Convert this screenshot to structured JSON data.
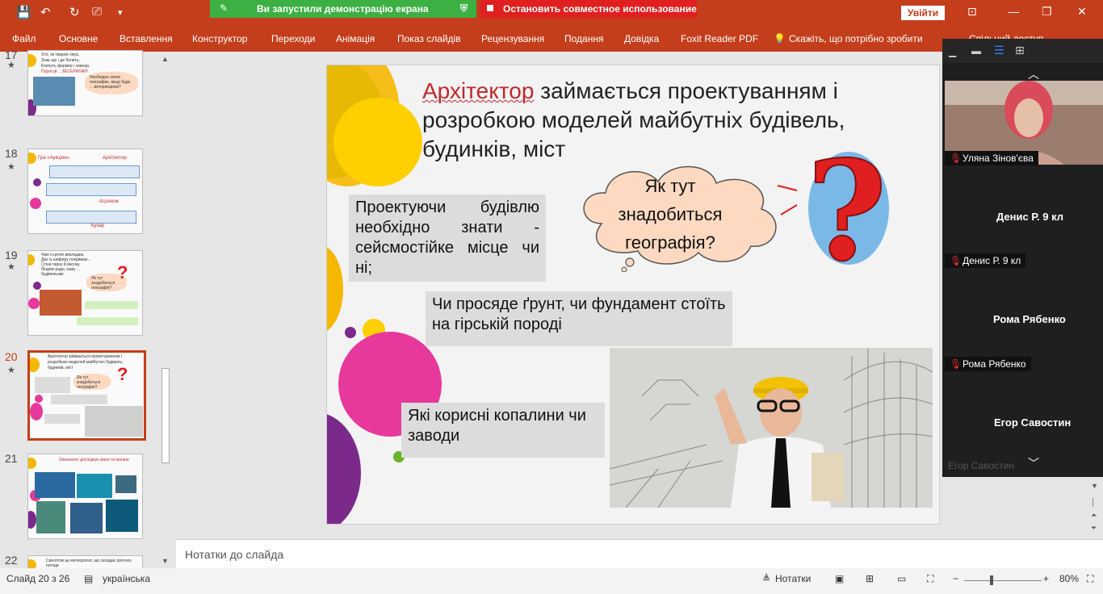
{
  "titlebar": {
    "save_icon": "save-icon",
    "share_banner": "Ви запустили демонстрацію екрана",
    "stop_banner": "Остановить совместное использование",
    "signin": "Увійти"
  },
  "ribbon": {
    "tabs": [
      "Файл",
      "Основне",
      "Вставлення",
      "Конструктор",
      "Переходи",
      "Анімація",
      "Показ слайдів",
      "Рецензування",
      "Подання",
      "Довідка",
      "Foxit Reader PDF",
      "Скажіть, що потрібно зробити",
      "Спільний доступ"
    ]
  },
  "thumbnails": [
    {
      "num": "17",
      "lines": [
        "Хто, як тварин лікує,",
        "Знає що і де болить,",
        "Кличуть фермер і свинар,",
        "Порятуй ... ВЕТЕРИНАР!"
      ],
      "bubble": "Необхідно знати географію, якщо буде ... ветеринаром?"
    },
    {
      "num": "18",
      "heading": "Гра «Аукціон»",
      "lines": [
        "Архітектор",
        "Агроном",
        "Кухар"
      ]
    },
    {
      "num": "19",
      "lines": [
        "Чим я цегли викладаю,",
        "Дах із шиферу покриваю...",
        "Стіни гарну й високу",
        "Людям радо, кажу ... будівельник"
      ],
      "bubble": "Як тут знадобиться географія?"
    },
    {
      "num": "20",
      "lines": [
        "Архітектор займається проектуванням і розробкою моделей майбутніх будівель, будинків, міст"
      ],
      "bubble": "Як тут знадобиться географія?"
    },
    {
      "num": "21",
      "lines": [
        "Океанолог досліджує моря та океани"
      ]
    },
    {
      "num": "22",
      "lines": [
        "Синоптик це метеоролог, що складає прогноз погоди"
      ]
    }
  ],
  "slide": {
    "title_highlight": "Архітектор",
    "title_rest": "займається проектуванням і розробкою моделей майбутніх будівель, будинків, міст",
    "box1": "Проектуючи будівлю необхідно знати - сейсмостійке місце чи ні;",
    "box2": "Чи просяде ґрунт, чи фундамент стоїть на гірській породі",
    "box3": "Які корисні копалини чи заводи",
    "cloud": "Як тут знадобиться географія?",
    "question_mark": "?"
  },
  "notes": {
    "placeholder": "Нотатки до слайда"
  },
  "status": {
    "slide_info": "Слайд 20 з 26",
    "language": "українська",
    "notes_button": "Нотатки",
    "zoom": "80%"
  },
  "participants": [
    {
      "name": "Уляна Зінов'єва",
      "has_video": true
    },
    {
      "name": "Денис Р. 9 кл",
      "has_video": false
    },
    {
      "name": "Рома Рябенко",
      "has_video": false
    },
    {
      "name": "Егор Савостин",
      "has_video": false
    }
  ],
  "colors": {
    "brand": "#c43e1c",
    "share": "#3cb043",
    "stop": "#e02020",
    "title_red": "#c0282d"
  }
}
